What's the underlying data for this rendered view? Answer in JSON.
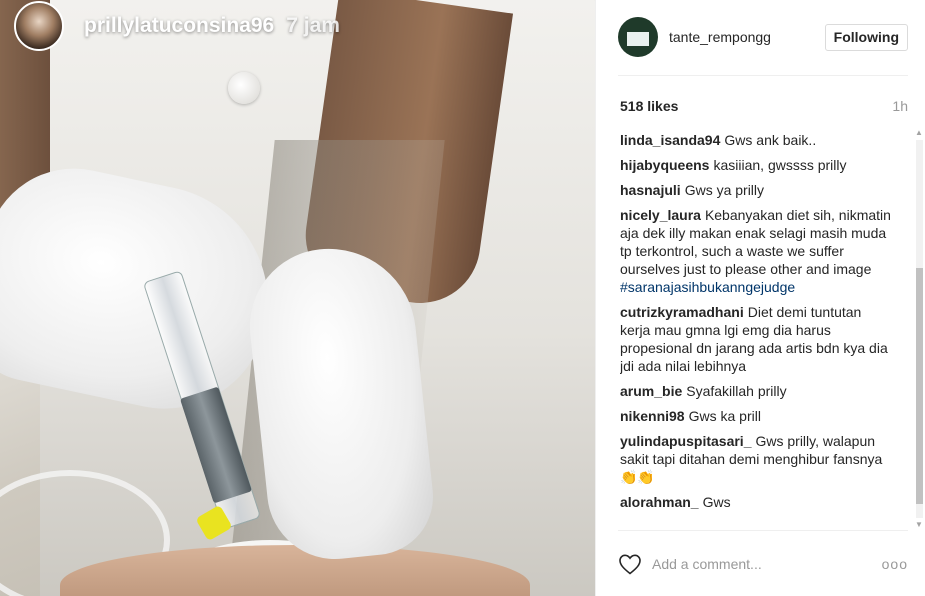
{
  "story": {
    "username": "prillylatuconsina96",
    "time": "7 jam"
  },
  "post": {
    "username": "tante_rempongg",
    "follow_label": "Following",
    "likes": "518 likes",
    "age": "1h",
    "add_comment_placeholder": "Add a comment...",
    "more_label": "ooo"
  },
  "comments": [
    {
      "user": "linda_isanda94",
      "text": "Gws ank baik.."
    },
    {
      "user": "hijabyqueens",
      "text": "kasiiian, gwssss prilly"
    },
    {
      "user": "hasnajuli",
      "text": "Gws ya prilly"
    },
    {
      "user": "nicely_laura",
      "text": "Kebanyakan diet sih, nikmatin aja dek illy makan enak selagi masih muda tp terkontrol, such a waste we suffer ourselves just to please other and image",
      "tag": "#saranajasihbukanngejudge"
    },
    {
      "user": "cutrizkyramadhani",
      "text": "Diet demi tuntutan kerja mau gmna lgi emg dia harus propesional dn jarang ada artis bdn kya dia jdi ada nilai lebihnya"
    },
    {
      "user": "arum_bie",
      "text": "Syafakillah prilly"
    },
    {
      "user": "nikenni98",
      "text": "Gws ka prill"
    },
    {
      "user": "yulindapuspitasari_",
      "text": "Gws prilly, walapun sakit tapi ditahan demi menghibur fansnya👏👏"
    },
    {
      "user": "alorahman_",
      "text": "Gws"
    }
  ]
}
